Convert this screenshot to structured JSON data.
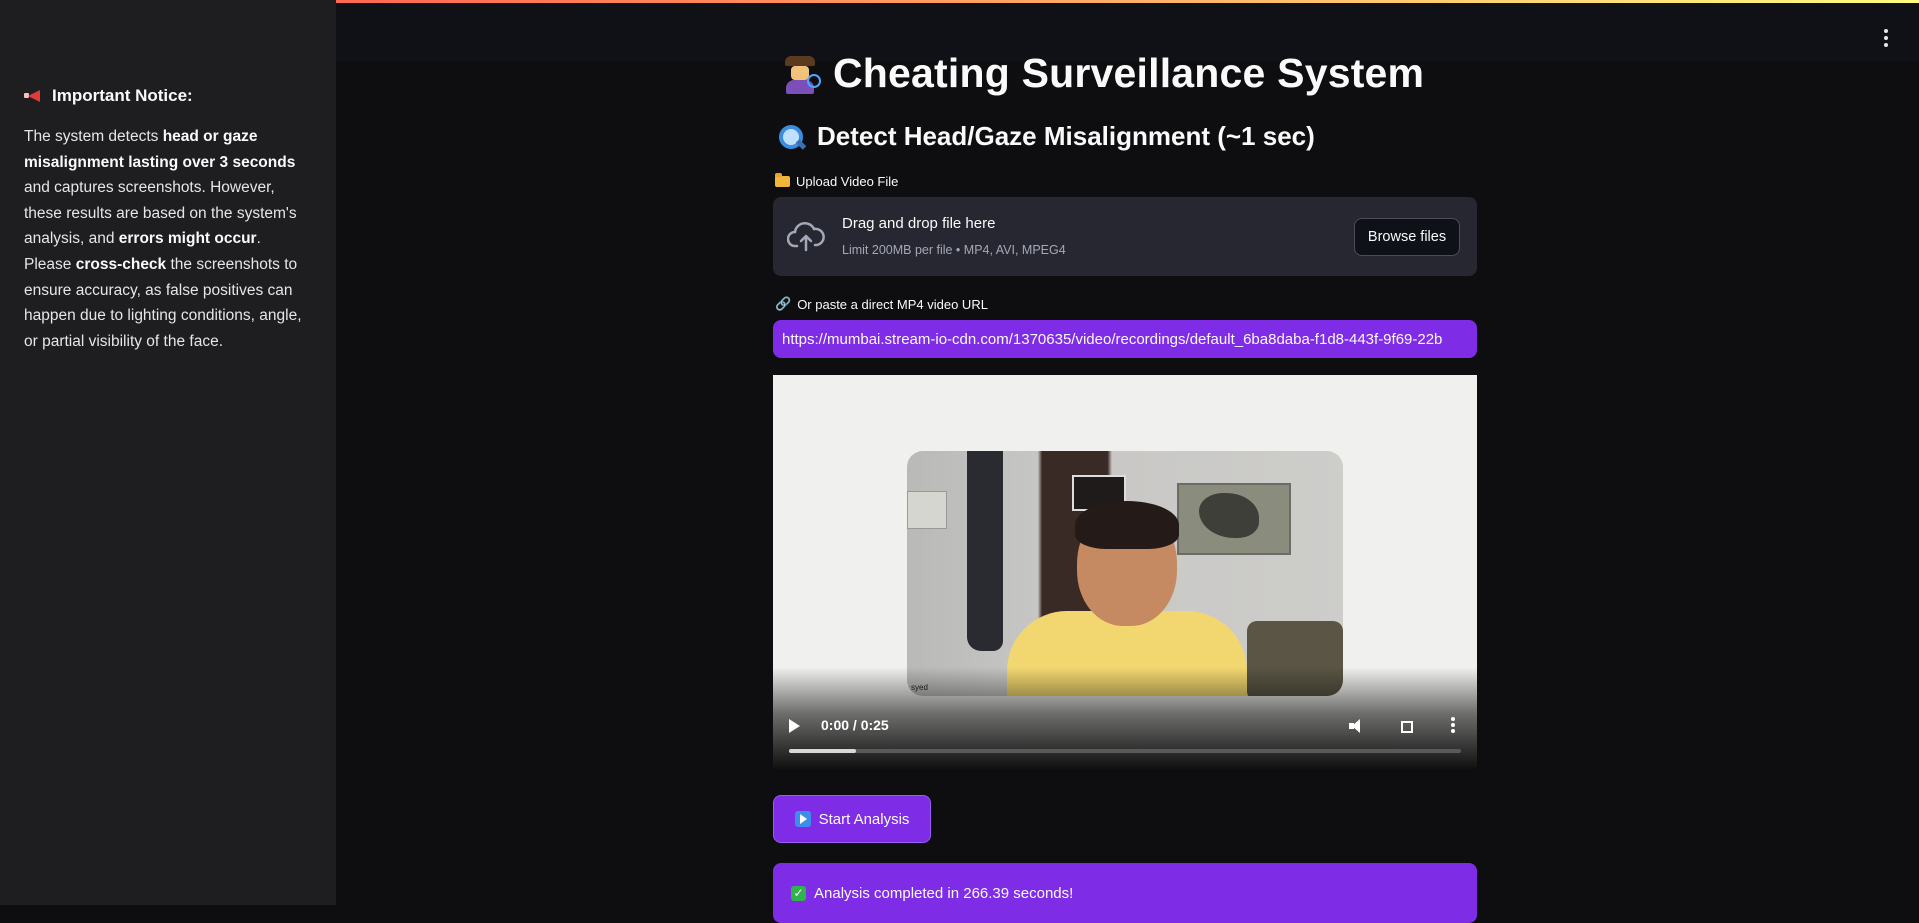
{
  "sidebar": {
    "notice_title": "Important Notice:",
    "notice_parts": {
      "p1": "The system detects ",
      "b1": "head or gaze misalignment lasting over 3 seconds",
      "p2": " and captures screenshots. However, these results are based on the system's analysis, and ",
      "b2": "errors might occur",
      "p3": ". Please ",
      "b3": "cross-check",
      "p4": " the screenshots to ensure accuracy, as false positives can happen due to lighting conditions, angle, or partial visibility of the face."
    }
  },
  "header": {
    "menu_icon": "kebab-menu-icon"
  },
  "main": {
    "title": "Cheating Surveillance System",
    "subtitle": "Detect Head/Gaze Misalignment (~1 sec)",
    "upload_label": "Upload Video File",
    "dropzone": {
      "title": "Drag and drop file here",
      "limit": "Limit 200MB per file • MP4, AVI, MPEG4",
      "browse_label": "Browse files"
    },
    "url_label": "Or paste a direct MP4 video URL",
    "url_value": "https://mumbai.stream-io-cdn.com/1370635/video/recordings/default_6ba8daba-f1d8-443f-9f69-22b",
    "video": {
      "time": "0:00 / 0:25",
      "progress": 0.1,
      "watermark": "syed"
    },
    "start_button": "Start Analysis",
    "success_text": "Analysis completed in 266.39 seconds!"
  },
  "colors": {
    "accent": "#7e2ce6",
    "sidebar_bg": "#1e1e21",
    "page_bg": "#0e0e10"
  }
}
